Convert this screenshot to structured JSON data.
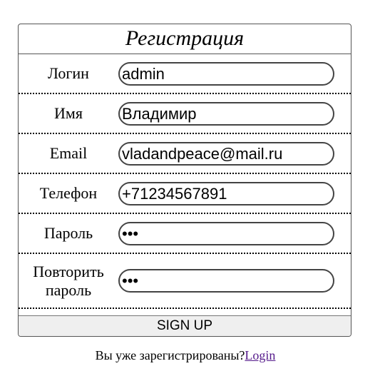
{
  "form": {
    "title": "Регистрация",
    "fields": [
      {
        "label": "Логин",
        "value": "admin"
      },
      {
        "label": "Имя",
        "value": "Владимир"
      },
      {
        "label": "Email",
        "value": "vladandpeace@mail.ru"
      },
      {
        "label": "Телефон",
        "value": "+71234567891"
      },
      {
        "label": "Пароль",
        "value": "•••"
      },
      {
        "label_line1": "Повторить",
        "label_line2": "пароль",
        "value": "•••"
      }
    ],
    "submit_label": "SIGN UP"
  },
  "footer": {
    "text": "Вы уже зарегистрированы?",
    "link_label": "Login"
  }
}
